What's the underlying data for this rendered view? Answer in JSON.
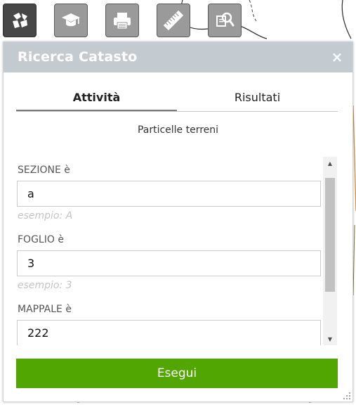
{
  "toolbar": {
    "buttons": [
      {
        "icon": "catasto-parcels-icon",
        "active": true
      },
      {
        "icon": "graduation-cap-icon",
        "active": false
      },
      {
        "icon": "printer-icon",
        "active": false
      },
      {
        "icon": "ruler-icon",
        "active": false
      },
      {
        "icon": "document-search-icon",
        "active": false
      }
    ]
  },
  "panel": {
    "title": "Ricerca Catasto",
    "close_label": "×",
    "tabs": [
      {
        "label": "Attività",
        "active": true
      },
      {
        "label": "Risultati",
        "active": false
      }
    ],
    "subtitle": "Particelle terreni",
    "fields": [
      {
        "label": "SEZIONE è",
        "value": "a",
        "hint": "esempio: A"
      },
      {
        "label": "FOGLIO è",
        "value": "3",
        "hint": "esempio: 3"
      },
      {
        "label": "MAPPALE è",
        "value": "222"
      }
    ],
    "submit_label": "Esegui"
  },
  "colors": {
    "header_bg": "#c3cbd1",
    "submit_bg": "#52a602",
    "active_tool_bg": "#474747",
    "tool_bg": "#9a9a9a"
  }
}
